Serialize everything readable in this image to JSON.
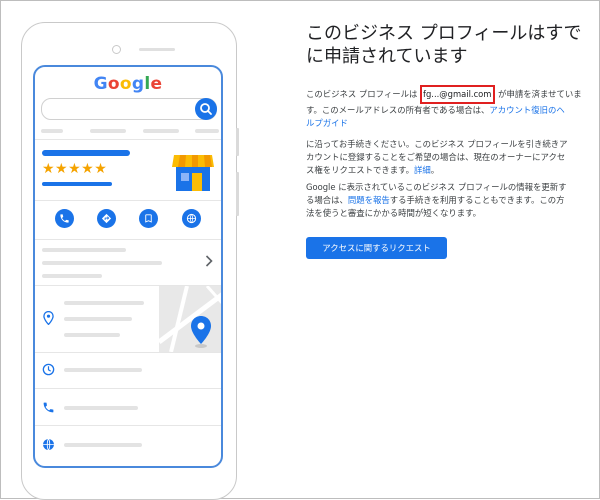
{
  "logo": {
    "letters": [
      "G",
      "o",
      "o",
      "g",
      "l",
      "e"
    ],
    "colors": [
      "#4285f4",
      "#ea4335",
      "#fbbc05",
      "#4285f4",
      "#34a853",
      "#ea4335"
    ]
  },
  "rating": {
    "stars": "★★★★★",
    "value": 5,
    "max": 5
  },
  "icons": {
    "search": "search-icon",
    "phone": "phone-icon",
    "directions": "directions-icon",
    "save": "bookmark-icon",
    "website": "globe-icon",
    "chevron": "chevron-right-icon",
    "location": "location-pin-icon",
    "hours": "clock-icon",
    "call": "phone-icon",
    "web": "globe-icon",
    "store": "storefront-icon"
  },
  "colors": {
    "accent": "#1a73e8",
    "highlight_border": "#e02020",
    "star": "#f5a300"
  },
  "content": {
    "heading_line1": "このビジネス プロフィールはすで",
    "heading_line2": "に申請されています",
    "p1_before": "このビジネス プロフィールは ",
    "p1_email": "fg...@gmail.com",
    "p1_after_line1": " が申請を済ませていま",
    "p1_line2": "す。このメールアドレスの所有者である場合は、",
    "p1_link_line2": "アカウント復旧のヘ",
    "p1_link_line3": "ルプガイド",
    "p2_line1": "に沿ってお手続きください。このビジネス プロフィールを引き続きア",
    "p2_line2": "カウントに登録することをご希望の場合は、現在のオーナーにアクセ",
    "p2_line3": "ス権をリクエストできます。",
    "p2_link": "詳細",
    "p2_end": "。",
    "p3_line1": "Google に表示されているこのビジネス プロフィールの情報を更新す",
    "p3_line2_before": "る場合は、",
    "p3_link": "問題を報告",
    "p3_line2_after": "する手続きを利用することもできます。この方",
    "p3_line3": "法を使うと審査にかかる時間が短くなります。",
    "request_button": "アクセスに関するリクエスト"
  }
}
